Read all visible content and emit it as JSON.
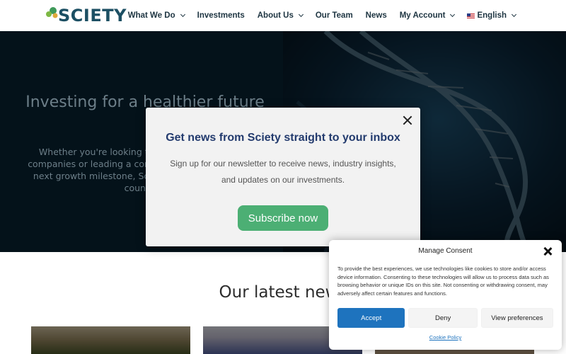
{
  "header": {
    "logo_text": "SCIETY",
    "nav": [
      {
        "label": "What We Do",
        "dropdown": true
      },
      {
        "label": "Investments",
        "dropdown": false
      },
      {
        "label": "About Us",
        "dropdown": true
      },
      {
        "label": "Our Team",
        "dropdown": false
      },
      {
        "label": "News",
        "dropdown": false
      },
      {
        "label": "My Account",
        "dropdown": true
      },
      {
        "label": "English",
        "dropdown": true,
        "icon": "us-flag-icon"
      }
    ]
  },
  "hero": {
    "title": "Investing for a healthier future",
    "subtitle": "Whether you're looking to invest in life sciences companies or leading a company looking to reach its next growth milestone, Sciety is a partner you can count on."
  },
  "newsletter_modal": {
    "title": "Get news from Sciety straight to your inbox",
    "text": "Sign up for our newsletter to receive news, industry insights, and updates on our investments.",
    "button": "Subscribe now",
    "button_color": "#4caf74"
  },
  "news_section": {
    "heading": "Our latest news"
  },
  "consent": {
    "title": "Manage Consent",
    "body": "To provide the best experiences, we use technologies like cookies to store and/or access device information. Consenting to these technologies will allow us to process data such as browsing behavior or unique IDs on this site. Not consenting or withdrawing consent, may adversely affect certain features and functions.",
    "accept": "Accept",
    "deny": "Deny",
    "preferences": "View preferences",
    "policy_link": "Cookie Policy",
    "accent_color": "#1e73be"
  }
}
